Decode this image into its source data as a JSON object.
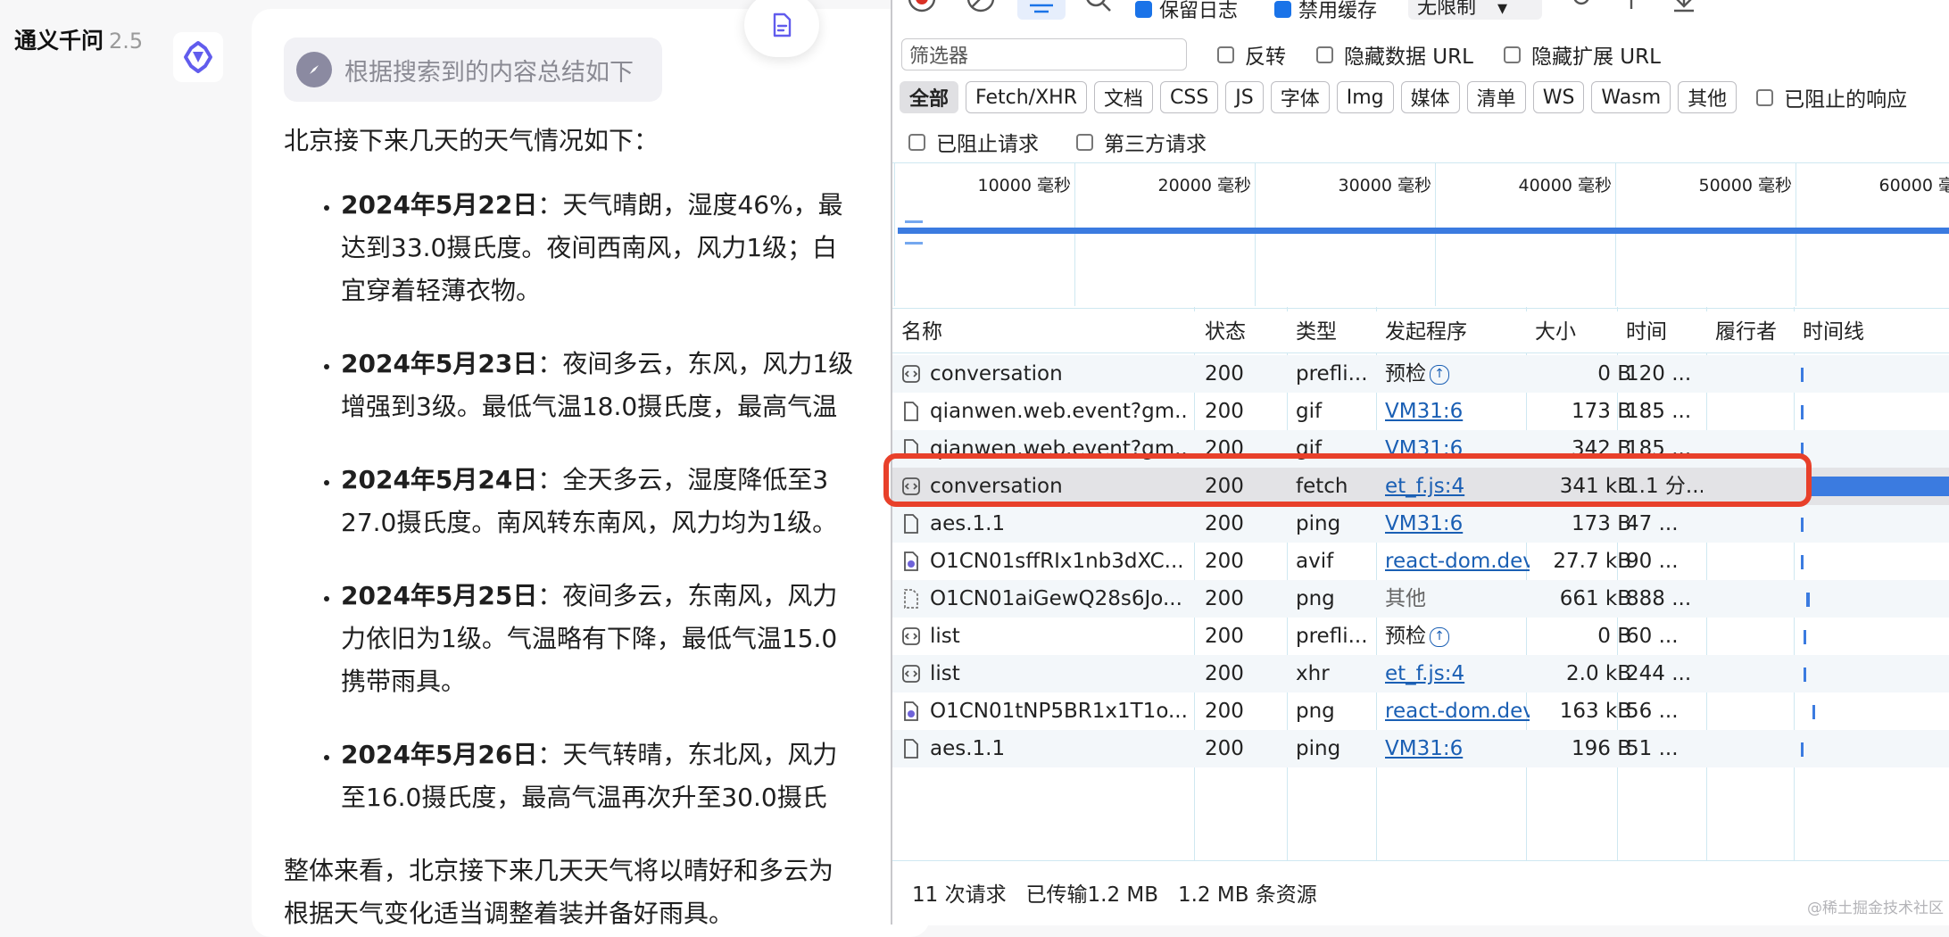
{
  "brand": {
    "name": "通义千问",
    "version": "2.5"
  },
  "chat": {
    "search_chip": "根据搜索到的内容总结如下",
    "intro": "北京接下来几天的天气情况如下：",
    "items": [
      {
        "date": "2024年5月22日",
        "line1": "：天气晴朗，湿度46%，最",
        "line2": "达到33.0摄氏度。夜间西南风，风力1级；白",
        "line3": "宜穿着轻薄衣物。"
      },
      {
        "date": "2024年5月23日",
        "line1": "：夜间多云，东风，风力1级",
        "line2": "增强到3级。最低气温18.0摄氏度，最高气温"
      },
      {
        "date": "2024年5月24日",
        "line1": "：全天多云，湿度降低至3",
        "line2": "27.0摄氏度。南风转东南风，风力均为1级。"
      },
      {
        "date": "2024年5月25日",
        "line1": "：夜间多云，东南风，风力",
        "line2": "力依旧为1级。气温略有下降，最低气温15.0",
        "line3": "携带雨具。"
      },
      {
        "date": "2024年5月26日",
        "line1": "：天气转晴，东北风，风力",
        "line2": "至16.0摄氏度，最高气温再次升至30.0摄氏"
      }
    ],
    "summary_line1": "整体来看，北京接下来几天天气将以晴好和多云为",
    "summary_line2": "根据天气变化适当调整着装并备好雨具。"
  },
  "devtools": {
    "toolbar": {
      "preserve_log": "保留日志",
      "disable_cache": "禁用缓存",
      "throttle": "无限制"
    },
    "filter": {
      "placeholder": "筛选器",
      "invert": "反转",
      "hide_data_url": "隐藏数据 URL",
      "hide_ext_url": "隐藏扩展 URL"
    },
    "types": [
      "全部",
      "Fetch/XHR",
      "文档",
      "CSS",
      "JS",
      "字体",
      "Img",
      "媒体",
      "清单",
      "WS",
      "Wasm",
      "其他"
    ],
    "blocked_responses": "已阻止的响应",
    "blocked_requests": "已阻止请求",
    "third_party": "第三方请求",
    "overview_ticks": [
      "10000",
      "20000",
      "30000",
      "40000",
      "50000",
      "60000"
    ],
    "overview_unit": "毫秒",
    "columns": {
      "name": "名称",
      "status": "状态",
      "type": "类型",
      "initiator": "发起程序",
      "size": "大小",
      "time": "时间",
      "fulfilled_by": "履行者",
      "waterfall": "时间线"
    },
    "rows": [
      {
        "name": "conversation",
        "icon": "fetch",
        "status": "200",
        "type": "prefli...",
        "initiator": "预检",
        "init_kind": "preflight",
        "size": "0 B",
        "time": "120 ...",
        "wf_left": 0.01,
        "wf_width": 0.01
      },
      {
        "name": "qianwen.web.event?gm...",
        "icon": "doc",
        "status": "200",
        "type": "gif",
        "initiator": "VM31:6",
        "init_kind": "link",
        "size": "173 B",
        "time": "185 ...",
        "wf_left": 0.01,
        "wf_width": 0.01
      },
      {
        "name": "qianwen.web.event?gm...",
        "icon": "doc",
        "status": "200",
        "type": "gif",
        "initiator": "VM31:6",
        "init_kind": "link",
        "size": "342 B",
        "time": "185 ...",
        "wf_left": 0.01,
        "wf_width": 0.01
      },
      {
        "name": "conversation",
        "icon": "fetch",
        "status": "200",
        "type": "fetch",
        "initiator": "et_f.js:4",
        "init_kind": "link",
        "size": "341 kB",
        "time": "1.1 分...",
        "wf_left": 0.06,
        "wf_width": 0.94,
        "selected": true
      },
      {
        "name": "aes.1.1",
        "icon": "doc",
        "status": "200",
        "type": "ping",
        "initiator": "VM31:6",
        "init_kind": "link",
        "size": "173 B",
        "time": "47 ...",
        "wf_left": 0.01,
        "wf_width": 0.01
      },
      {
        "name": "O1CN01sffRIx1nb3dXC...",
        "icon": "img",
        "status": "200",
        "type": "avif",
        "initiator": "react-dom.dev",
        "init_kind": "link",
        "size": "27.7 kB",
        "time": "90 ...",
        "wf_left": 0.01,
        "wf_width": 0.01
      },
      {
        "name": "O1CN01aiGewQ28s6Jo...",
        "icon": "png",
        "status": "200",
        "type": "png",
        "initiator": "其他",
        "init_kind": "gray",
        "size": "661 kB",
        "time": "888 ...",
        "wf_left": 0.05,
        "wf_width": 0.02
      },
      {
        "name": "list",
        "icon": "fetch",
        "status": "200",
        "type": "prefli...",
        "initiator": "预检",
        "init_kind": "preflight",
        "size": "0 B",
        "time": "60 ...",
        "wf_left": 0.03,
        "wf_width": 0.01
      },
      {
        "name": "list",
        "icon": "fetch",
        "status": "200",
        "type": "xhr",
        "initiator": "et_f.js:4",
        "init_kind": "link",
        "size": "2.0 kB",
        "time": "244 ...",
        "wf_left": 0.03,
        "wf_width": 0.01
      },
      {
        "name": "O1CN01tNP5BR1x1T1o...",
        "icon": "img",
        "status": "200",
        "type": "png",
        "initiator": "react-dom.dev",
        "init_kind": "link",
        "size": "163 kB",
        "time": "56 ...",
        "wf_left": 0.09,
        "wf_width": 0.01
      },
      {
        "name": "aes.1.1",
        "icon": "doc",
        "status": "200",
        "type": "ping",
        "initiator": "VM31:6",
        "init_kind": "link",
        "size": "196 B",
        "time": "51 ...",
        "wf_left": 0.01,
        "wf_width": 0.01
      }
    ],
    "status_bar": {
      "requests": "11 次请求",
      "transferred": "已传输1.2 MB",
      "resources": "1.2 MB 条资源"
    }
  },
  "watermark": "@稀土掘金技术社区",
  "colors": {
    "accent": "#1a73e8",
    "highlight": "#e8402a",
    "waterfall": "#3b7be0",
    "link": "#1a5fb4"
  }
}
